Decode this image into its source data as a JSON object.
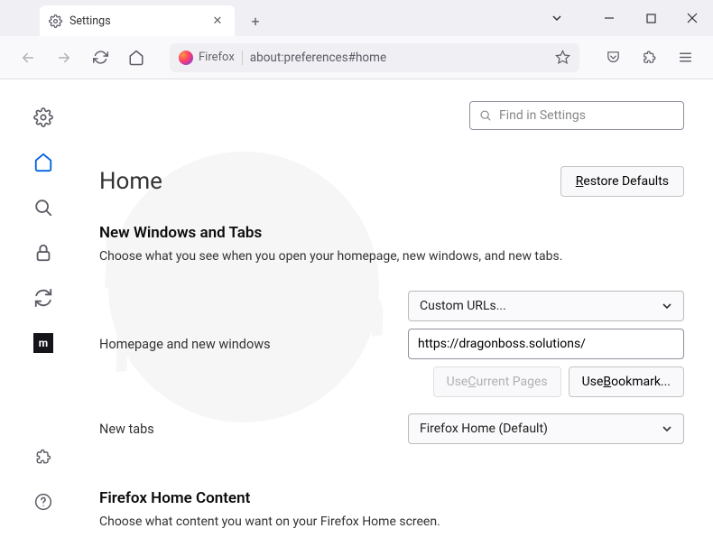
{
  "window": {
    "tab_title": "Settings",
    "identity_label": "Firefox",
    "url": "about:preferences#home"
  },
  "search": {
    "placeholder": "Find in Settings"
  },
  "page": {
    "title": "Home",
    "restore_defaults": "Restore Defaults",
    "section1_title": "New Windows and Tabs",
    "section1_desc": "Choose what you see when you open your homepage, new windows, and new tabs.",
    "homepage_dropdown": "Custom URLs...",
    "homepage_label": "Homepage and new windows",
    "homepage_value": "https://dragonboss.solutions/",
    "use_current": "Use Current Pages",
    "use_bookmark": "Use Bookmark...",
    "newtabs_label": "New tabs",
    "newtabs_dropdown": "Firefox Home (Default)",
    "section2_title": "Firefox Home Content",
    "section2_desc": "Choose what content you want on your Firefox Home screen."
  }
}
